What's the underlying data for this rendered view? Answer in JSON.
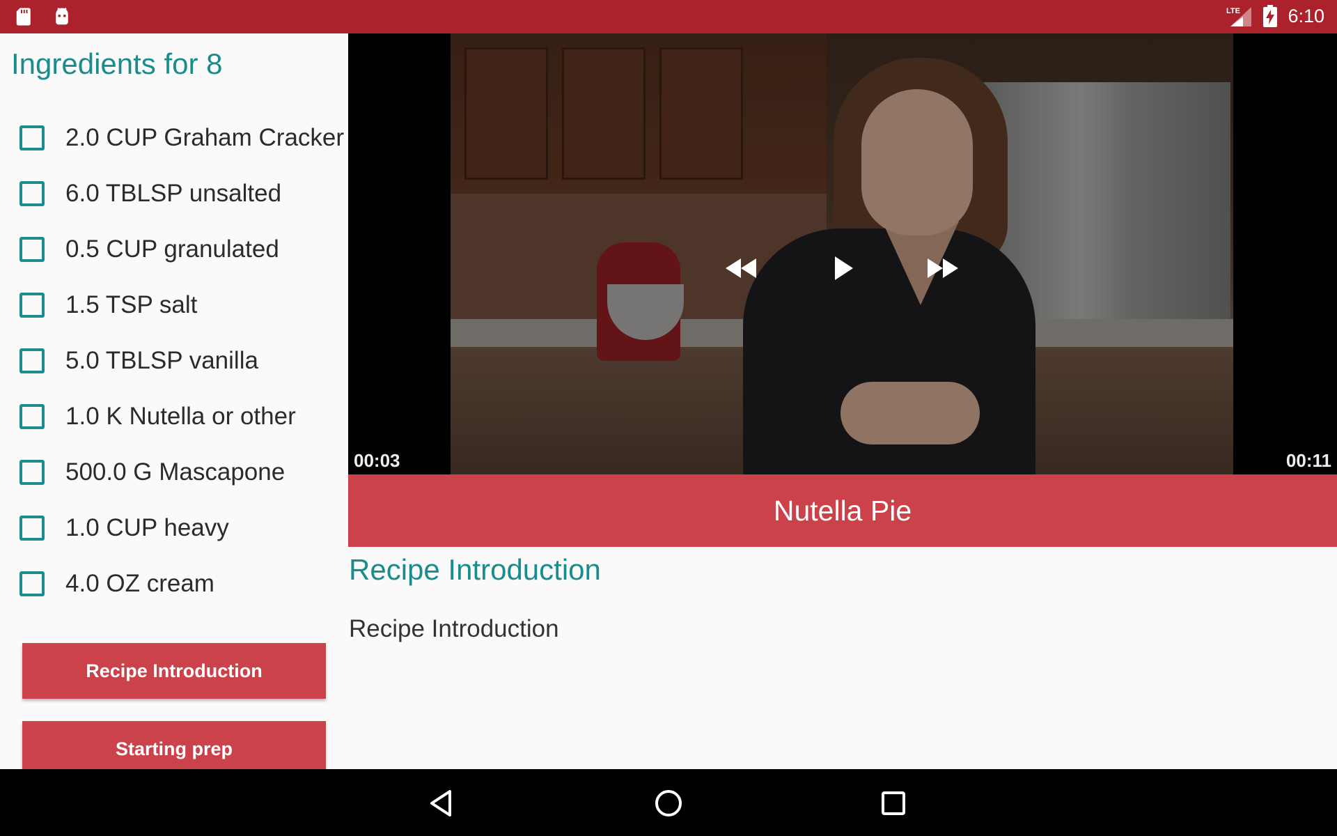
{
  "status_bar": {
    "time": "6:10",
    "network_label": "LTE",
    "color": "#ab222c",
    "left_icons": [
      "sd-card-icon",
      "android-debug-icon"
    ],
    "right_icons": [
      "lte-signal-icon",
      "battery-charging-icon"
    ]
  },
  "ingredients": {
    "title": "Ingredients for 8",
    "items": [
      {
        "label": "2.0 CUP Graham Cracker",
        "checked": false
      },
      {
        "label": "6.0 TBLSP unsalted",
        "checked": false
      },
      {
        "label": "0.5 CUP granulated",
        "checked": false
      },
      {
        "label": "1.5 TSP salt",
        "checked": false
      },
      {
        "label": "5.0 TBLSP vanilla",
        "checked": false
      },
      {
        "label": "1.0 K Nutella or other",
        "checked": false
      },
      {
        "label": "500.0 G Mascapone",
        "checked": false
      },
      {
        "label": "1.0 CUP heavy",
        "checked": false
      },
      {
        "label": "4.0 OZ cream",
        "checked": false
      }
    ]
  },
  "steps": {
    "buttons": [
      "Recipe Introduction",
      "Starting prep"
    ]
  },
  "video": {
    "position": "00:03",
    "duration": "00:11",
    "progress_fraction": 0.25,
    "controls": [
      "rewind-icon",
      "play-icon",
      "fast-forward-icon"
    ]
  },
  "recipe": {
    "name": "Nutella Pie",
    "accent_color": "#cc424a"
  },
  "step_detail": {
    "heading": "Recipe Introduction",
    "description": "Recipe Introduction",
    "heading_color": "#1a8c8c"
  },
  "nav_bar": {
    "buttons": [
      "back-icon",
      "home-icon",
      "recents-icon"
    ]
  }
}
